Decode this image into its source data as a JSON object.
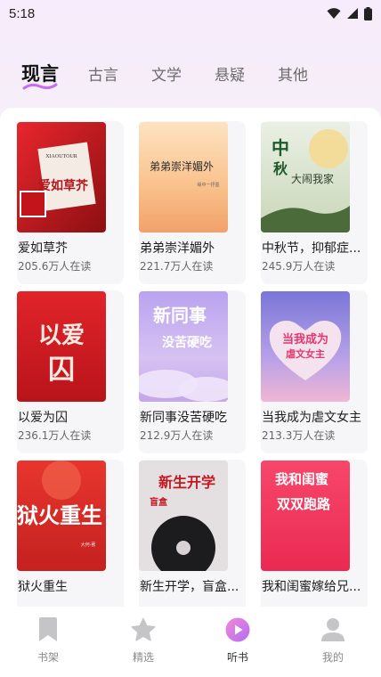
{
  "status_bar": {
    "time": "5:18"
  },
  "tabs": [
    {
      "label": "现言",
      "active": true
    },
    {
      "label": "古言",
      "active": false
    },
    {
      "label": "文学",
      "active": false
    },
    {
      "label": "悬疑",
      "active": false
    },
    {
      "label": "其他",
      "active": false
    }
  ],
  "accent_color": "#c86cf0",
  "books": [
    {
      "title": "爱如草芥",
      "readers": "205.6万人在读",
      "cover_text": "爱如草芥",
      "cover_sub": "XIAOUTOUR"
    },
    {
      "title": "弟弟崇洋媚外",
      "readers": "221.7万人在读",
      "cover_text": "弟弟崇洋媚外",
      "cover_sub": "缘中一抒墨"
    },
    {
      "title": "中秋节，抑郁症...",
      "readers": "245.9万人在读",
      "cover_text": "中秋节",
      "cover_sub": "大闹我家"
    },
    {
      "title": "以爱为囚",
      "readers": "236.1万人在读",
      "cover_text": "以爱为囚",
      "cover_sub": ""
    },
    {
      "title": "新同事没苦硬吃",
      "readers": "212.9万人在读",
      "cover_text": "新同事没苦硬吃",
      "cover_sub": ""
    },
    {
      "title": "当我成为虐文女主",
      "readers": "213.3万人在读",
      "cover_text": "当我成为虐文女主",
      "cover_sub": ""
    },
    {
      "title": "狱火重生",
      "readers": "",
      "cover_text": "狱火重生",
      "cover_sub": "大何·著"
    },
    {
      "title": "新生开学，盲盒...",
      "readers": "",
      "cover_text": "新生开学",
      "cover_sub": "盲盒"
    },
    {
      "title": "我和闺蜜嫁给兄...",
      "readers": "",
      "cover_text": "我和闺蜜",
      "cover_sub": "双双跑路"
    }
  ],
  "bottom_nav": [
    {
      "label": "书架",
      "icon": "bookmark-icon",
      "active": false
    },
    {
      "label": "精选",
      "icon": "star-icon",
      "active": false
    },
    {
      "label": "听书",
      "icon": "play-icon",
      "active": true
    },
    {
      "label": "我的",
      "icon": "user-icon",
      "active": false
    }
  ]
}
